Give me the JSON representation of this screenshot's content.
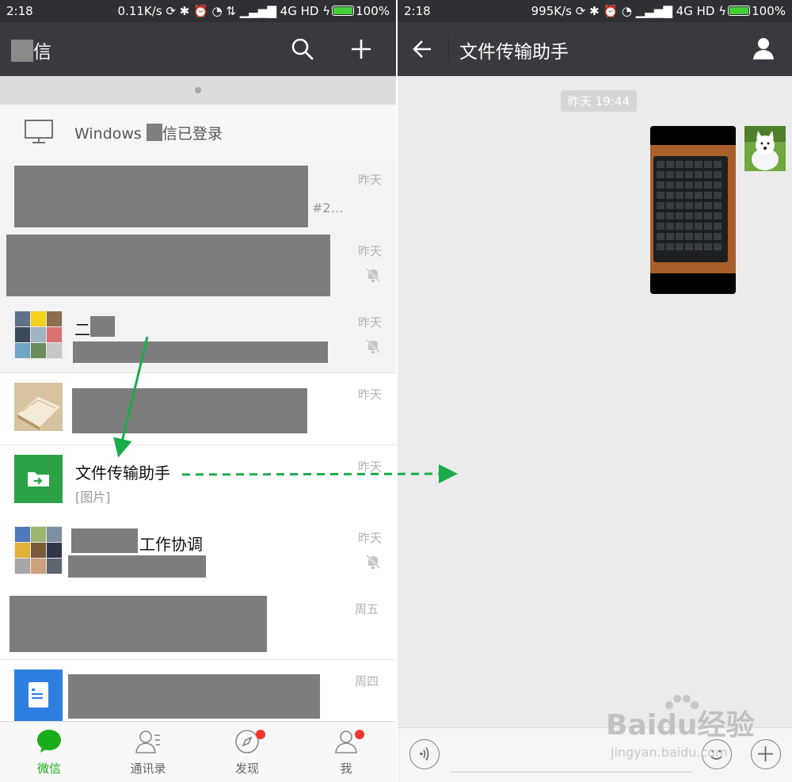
{
  "colors": {
    "accent_green": "#1aad19",
    "titlebar": "#393a3f",
    "statusbar": "#2e3033",
    "arrow_green": "#1aad4b",
    "badge_red": "#f43530"
  },
  "left_status": {
    "time": "2:18",
    "speed": "0.11K/s",
    "network": "4G HD",
    "battery": "100%"
  },
  "right_status": {
    "time": "2:18",
    "speed": "995K/s",
    "network": "4G HD",
    "battery": "100%"
  },
  "left_header": {
    "title_suffix": "信",
    "icons": [
      "search-icon",
      "plus-icon"
    ]
  },
  "login_banner": {
    "prefix": "Windows",
    "suffix": "信已登录",
    "icon": "monitor-icon"
  },
  "chats": [
    {
      "time": "昨天",
      "sub": "#2…",
      "muted": false
    },
    {
      "time": "昨天",
      "muted": true
    },
    {
      "name": "二",
      "time": "昨天",
      "muted": true
    },
    {
      "time": "昨天",
      "muted": false
    },
    {
      "name": "文件传输助手",
      "sub": "[图片]",
      "time": "昨天",
      "muted": false
    },
    {
      "name": "工作协调",
      "time": "昨天",
      "muted": true
    },
    {
      "time": "周五",
      "muted": false
    },
    {
      "time": "周四",
      "muted": false
    }
  ],
  "tabs": [
    {
      "label": "微信",
      "icon": "chat-bubble-icon",
      "active": true,
      "badge": false
    },
    {
      "label": "通讯录",
      "icon": "contacts-icon",
      "active": false,
      "badge": false
    },
    {
      "label": "发现",
      "icon": "compass-icon",
      "active": false,
      "badge": true
    },
    {
      "label": "我",
      "icon": "profile-icon",
      "active": false,
      "badge": true
    }
  ],
  "chat_view": {
    "title": "文件传输助手",
    "timestamp": "昨天 19:44",
    "icons": [
      "back-arrow-icon",
      "person-icon",
      "voice-icon",
      "emoji-icon",
      "plus-circle-icon"
    ]
  },
  "watermark": {
    "main": "Baidu经验",
    "sub": "jingyan.baidu.com"
  }
}
